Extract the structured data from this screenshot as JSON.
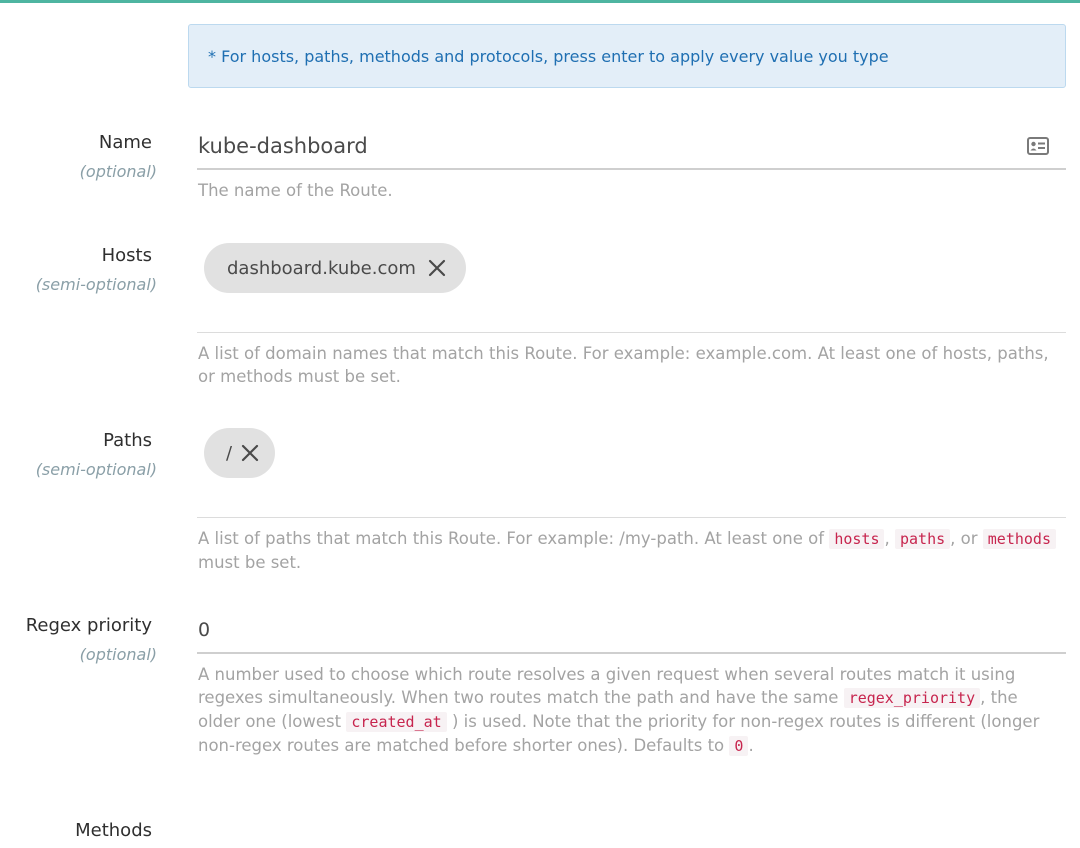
{
  "info_text": "* For hosts, paths, methods and protocols, press enter to apply every value you type",
  "name_field": {
    "label": "Name",
    "sub": "(optional)",
    "value": "kube-dashboard",
    "help": "The name of the Route."
  },
  "hosts_field": {
    "label": "Hosts",
    "sub": "(semi-optional)",
    "chips": [
      "dashboard.kube.com"
    ],
    "help": "A list of domain names that match this Route. For example: example.com. At least one of hosts, paths, or methods must be set."
  },
  "paths_field": {
    "label": "Paths",
    "sub": "(semi-optional)",
    "chips": [
      "/"
    ],
    "help_1": "A list of paths that match this Route. For example: /my-path. At least one of",
    "code_hosts": "hosts",
    "sep_1": ",",
    "code_paths": "paths",
    "sep_2": ", or",
    "code_methods": "methods",
    "help_2": "must be set."
  },
  "regex_field": {
    "label": "Regex priority",
    "sub": "(optional)",
    "value": "0",
    "help_1": "A number used to choose which route resolves a given request when several routes match it using regexes simultaneously. When two routes match the path and have the same",
    "code_regex": "regex_priority",
    "help_2": ", the older one (lowest",
    "code_created": "created_at",
    "help_3": ") is used. Note that the priority for non-regex routes is different (longer non-regex routes are matched before shorter ones). Defaults to",
    "code_zero": "0",
    "help_4": "."
  },
  "methods_field": {
    "label": "Methods"
  },
  "colors": {
    "accent": "#4eb5a1",
    "info_bg": "#e3eef8",
    "info_text": "#1f6fb2",
    "code": "#c7254e"
  }
}
